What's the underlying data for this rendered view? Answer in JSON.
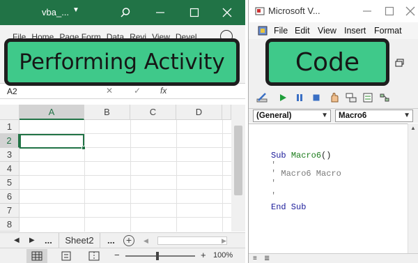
{
  "excel": {
    "title": "vba_...",
    "ribbon_tabs": [
      "File",
      "Home",
      "Page Form",
      "Data",
      "Revi",
      "View",
      "Devel",
      "(:"
    ],
    "name_box": "A2",
    "formula_symbol": "fx",
    "columns": [
      "A",
      "B",
      "C",
      "D"
    ],
    "selected_column": "A",
    "rows": [
      "1",
      "2",
      "3",
      "4",
      "5",
      "6",
      "7",
      "8"
    ],
    "selected_row": "2",
    "sheet_nav_ellipsis": "...",
    "active_sheet": "Sheet2",
    "sheet_nav_ellipsis_right": "...",
    "add_sheet": "+",
    "zoom_minus": "−",
    "zoom_plus": "+",
    "zoom": "100%"
  },
  "vbe": {
    "title": "Microsoft V...",
    "menu": [
      "File",
      "Edit",
      "View",
      "Insert",
      "Format"
    ],
    "object_combo": "(General)",
    "procedure_combo": "Macro6",
    "code": {
      "kw_sub": "Sub",
      "macro_name": "Macro6",
      "parens": "()",
      "comment1": "'",
      "comment2": "' Macro6 Macro",
      "comment3": "'",
      "comment4": "'",
      "end_sub": "End Sub"
    }
  },
  "overlay": {
    "left_label": "Performing Activity",
    "right_label": "Code"
  },
  "colors": {
    "excel_green": "#217346",
    "badge_green": "#3fc98a",
    "badge_border": "#1e1e1e"
  }
}
